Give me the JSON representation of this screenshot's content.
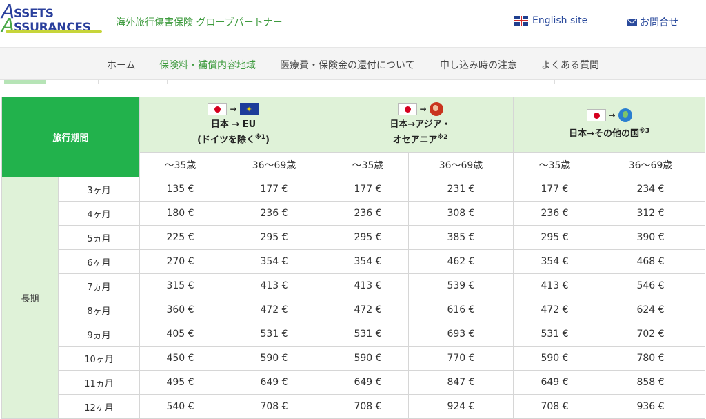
{
  "header": {
    "logo_line1": "SSETS",
    "logo_line2": "SSURANCES",
    "logo_big1": "A",
    "logo_big2": "A",
    "tagline": "海外旅行傷害保険 グローブパートナー",
    "english_link": "English site",
    "contact_link": "お問合せ"
  },
  "nav": {
    "items": [
      {
        "label": "ホーム",
        "active": false
      },
      {
        "label": "保険料・補償内容地域",
        "active": true
      },
      {
        "label": "医療費・保険金の還付について",
        "active": false
      },
      {
        "label": "申し込み時の注意",
        "active": false
      },
      {
        "label": "よくある質問",
        "active": false
      }
    ]
  },
  "table": {
    "period_header": "旅行期間",
    "destinations": [
      {
        "line1": "日本 → EU",
        "line2": "(ドイツを除く",
        "note": "※1",
        "line2_end": ")",
        "icon": "eu-flag-icon"
      },
      {
        "line1": "日本→アジア・",
        "line2": "オセアニア",
        "note": "※2",
        "line2_end": "",
        "icon": "globe-asia-icon"
      },
      {
        "line1": "日本→その他の国",
        "line2": "",
        "note": "※3",
        "line2_end": "",
        "icon": "globe-world-icon"
      }
    ],
    "arrow": "→",
    "age_groups": [
      "〜35歳",
      "36〜69歳",
      "〜35歳",
      "36〜69歳",
      "〜35歳",
      "36〜69歳"
    ],
    "category": "長期",
    "rows": [
      {
        "month": "3ヶ月",
        "prices": [
          "135 €",
          "177 €",
          "177 €",
          "231 €",
          "177 €",
          "234 €"
        ]
      },
      {
        "month": "4ヶ月",
        "prices": [
          "180 €",
          "236 €",
          "236 €",
          "308 €",
          "236 €",
          "312 €"
        ]
      },
      {
        "month": "5ヵ月",
        "prices": [
          "225 €",
          "295 €",
          "295 €",
          "385 €",
          "295 €",
          "390 €"
        ]
      },
      {
        "month": "6ヶ月",
        "prices": [
          "270 €",
          "354 €",
          "354 €",
          "462 €",
          "354 €",
          "468 €"
        ]
      },
      {
        "month": "7ヵ月",
        "prices": [
          "315 €",
          "413 €",
          "413 €",
          "539 €",
          "413 €",
          "546 €"
        ]
      },
      {
        "month": "8ヶ月",
        "prices": [
          "360 €",
          "472 €",
          "472 €",
          "616 €",
          "472 €",
          "624 €"
        ]
      },
      {
        "month": "9ヵ月",
        "prices": [
          "405 €",
          "531 €",
          "531 €",
          "693 €",
          "531 €",
          "702 €"
        ]
      },
      {
        "month": "10ヶ月",
        "prices": [
          "450 €",
          "590 €",
          "590 €",
          "770 €",
          "590 €",
          "780 €"
        ]
      },
      {
        "month": "11ヵ月",
        "prices": [
          "495 €",
          "649 €",
          "649 €",
          "847 €",
          "649 €",
          "858 €"
        ]
      },
      {
        "month": "12ヶ月",
        "prices": [
          "540 €",
          "708 €",
          "708 €",
          "924 €",
          "708 €",
          "936 €"
        ]
      }
    ]
  },
  "colors": {
    "brand_green": "#3e9b3e",
    "header_green": "#22b24c",
    "light_green": "#dff2d8",
    "link_blue": "#2a4a9c"
  }
}
